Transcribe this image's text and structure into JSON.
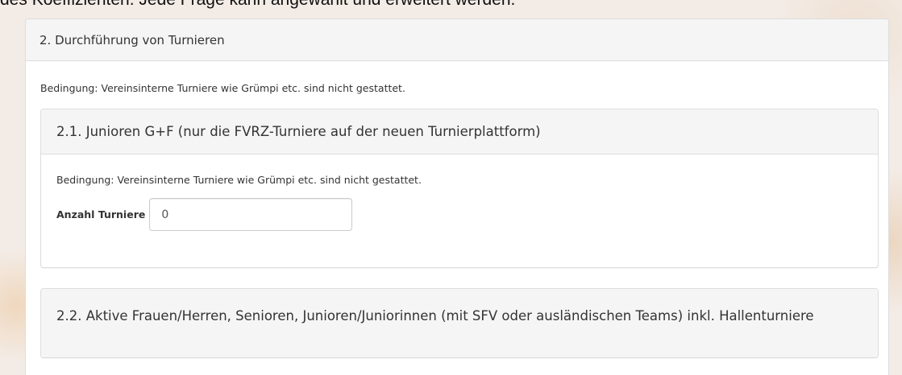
{
  "intro": {
    "text": "des Koeffizienten. Jede Frage kann angewählt und erweitert werden."
  },
  "section": {
    "heading": "2. Durchführung von Turnieren",
    "condition": "Bedingung: Vereinsinterne Turniere wie Grümpi etc. sind nicht gestattet.",
    "subsections": [
      {
        "heading": "2.1. Junioren G+F (nur die FVRZ-Turniere auf der neuen Turnierplattform)",
        "condition": "Bedingung: Vereinsinterne Turniere wie Grümpi etc. sind nicht gestattet.",
        "field_label": "Anzahl Turniere",
        "field_value": "0"
      },
      {
        "heading": "2.2. Aktive Frauen/Herren, Senioren, Junioren/Juniorinnen (mit SFV oder ausländischen Teams) inkl. Hallenturniere"
      }
    ]
  }
}
